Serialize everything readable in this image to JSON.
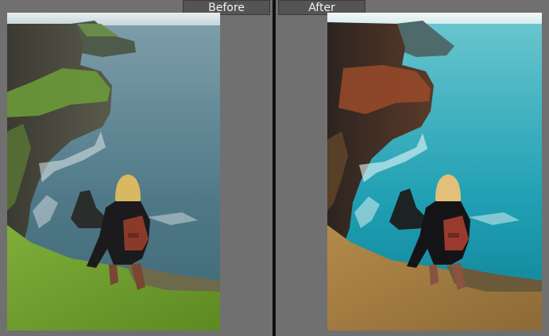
{
  "compare": {
    "before_label": "Before",
    "after_label": "After"
  },
  "colors": {
    "background": "#6f6f6f",
    "label_bg": "#545454",
    "divider": "#101010"
  }
}
